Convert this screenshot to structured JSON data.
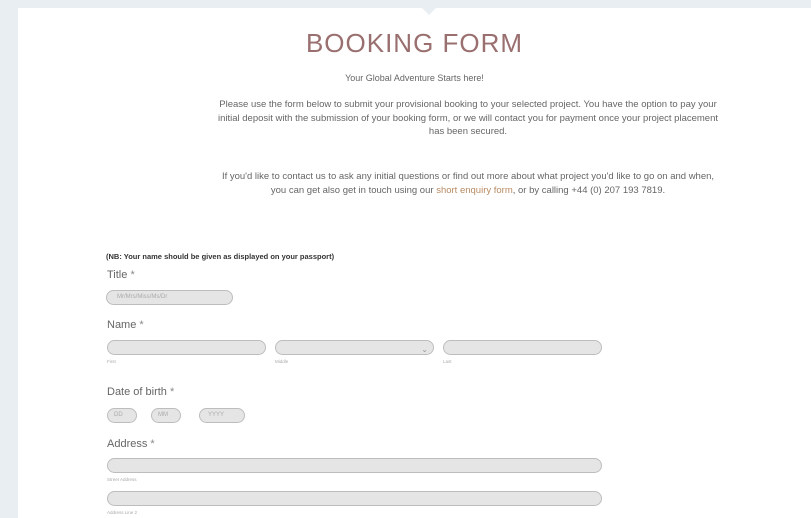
{
  "form": {
    "title": "BOOKING FORM",
    "tagline": "Your Global Adventure Starts here!",
    "intro_p1": "Please use the form below to submit your provisional booking to your selected project. You have the option to pay your initial deposit with the submission of your booking form, or we will contact you for payment once your project placement has been secured.",
    "intro_p2_before": "If you'd like to contact us to ask any initial questions or find out more about what project you'd like to go on and when, you can get also get in touch using our ",
    "intro_p2_link": "short enquiry form",
    "intro_p2_after": ", or by calling +44 (0) 207 193 7819.",
    "note": "(NB: Your name should be given as displayed on your passport)"
  },
  "fields": {
    "title": {
      "label": "Title",
      "required_mark": "*",
      "value": "Mr/Mrs/Miss/Ms/Dr"
    },
    "name": {
      "label": "Name",
      "required_mark": "*",
      "first_sub": "First",
      "middle_sub": "Middle",
      "last_sub": "Last"
    },
    "dob": {
      "label": "Date of birth",
      "required_mark": "*",
      "dd": "DD",
      "mm": "MM",
      "yyyy": "YYYY"
    },
    "address": {
      "label": "Address",
      "required_mark": "*",
      "street_sub": "Street Address",
      "line2_sub": "Address Line 2"
    }
  },
  "colors": {
    "title": "#9a6f6f",
    "link": "#b88a62",
    "field_bg": "#e5e5e5",
    "field_border": "#bdbdbd",
    "backdrop": "#e9eef3"
  }
}
